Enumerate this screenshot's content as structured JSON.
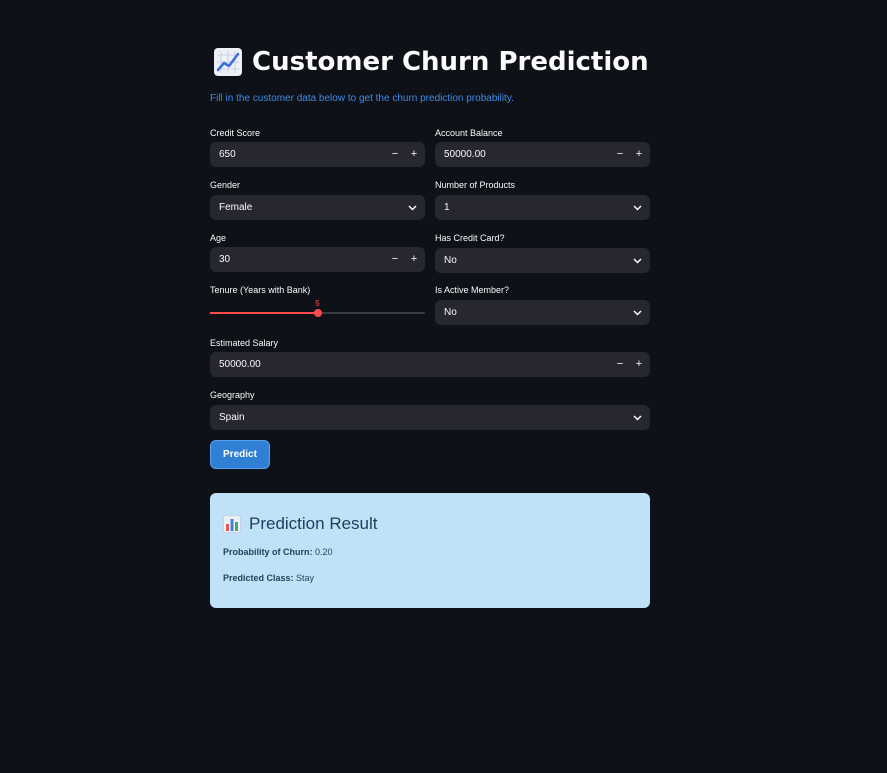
{
  "page": {
    "title": "Customer Churn Prediction",
    "title_icon": "chart-increasing-icon",
    "subtitle": "Fill in the customer data below to get the churn prediction probability."
  },
  "form": {
    "credit_score": {
      "label": "Credit Score",
      "value": "650"
    },
    "account_balance": {
      "label": "Account Balance",
      "value": "50000.00"
    },
    "gender": {
      "label": "Gender",
      "value": "Female"
    },
    "num_products": {
      "label": "Number of Products",
      "value": "1"
    },
    "age": {
      "label": "Age",
      "value": "30"
    },
    "has_credit_card": {
      "label": "Has Credit Card?",
      "value": "No"
    },
    "tenure": {
      "label": "Tenure (Years with Bank)",
      "value": "5",
      "min": 0,
      "max": 10
    },
    "is_active_member": {
      "label": "Is Active Member?",
      "value": "No"
    },
    "estimated_salary": {
      "label": "Estimated Salary",
      "value": "50000.00"
    },
    "geography": {
      "label": "Geography",
      "value": "Spain"
    },
    "stepper_minus": "−",
    "stepper_plus": "+",
    "predict_label": "Predict"
  },
  "result": {
    "icon": "bar-chart-icon",
    "title": "Prediction Result",
    "probability_label": "Probability of Churn:",
    "probability_value": "0.20",
    "class_label": "Predicted Class:",
    "class_value": "Stay"
  },
  "colors": {
    "background": "#0e1117",
    "input_bg": "#262730",
    "accent_blue": "#2f7fd4",
    "slider_red": "#ff4b4b",
    "result_bg": "#c0e2f8"
  }
}
